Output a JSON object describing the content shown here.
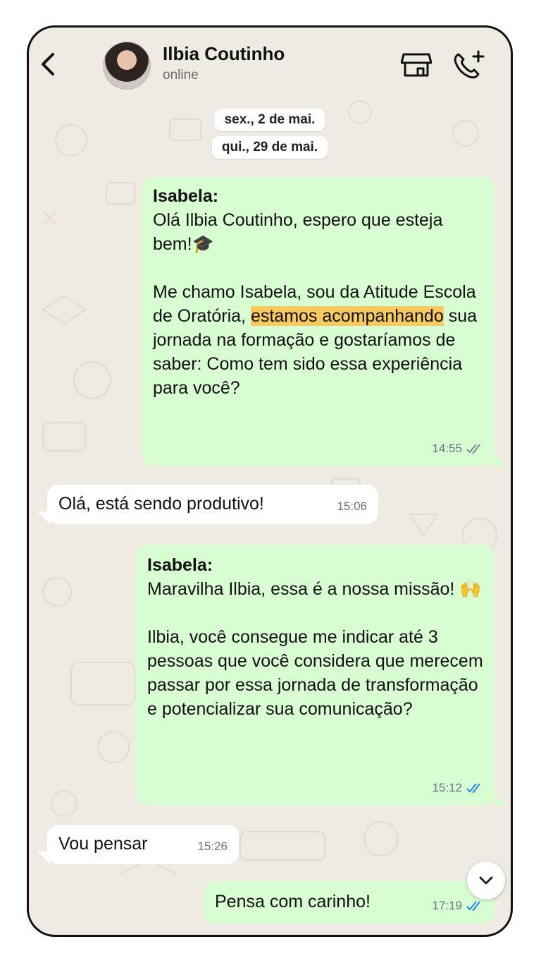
{
  "header": {
    "contact_name": "Ilbia Coutinho",
    "status": "online",
    "icons": [
      "back-chevron-icon",
      "avatar",
      "store-icon",
      "add-call-icon"
    ]
  },
  "dates": [
    "sex., 2 de mai.",
    "qui., 29 de mai."
  ],
  "messages": [
    {
      "direction": "outgoing",
      "sender": "Isabela:",
      "p1": "Olá Ilbia Coutinho, espero que esteja bem!🎓",
      "p2_before": "Me chamo Isabela, sou da Atitude Escola de Oratória, ",
      "p2_highlight": "estamos acompanhando",
      "p2_after": " sua jornada na formação e gostaríamos de saber: Como tem sido essa experiência para você?",
      "time": "14:55",
      "ticks": "read-gray"
    },
    {
      "direction": "incoming",
      "text": "Olá, está sendo produtivo!",
      "time": "15:06"
    },
    {
      "direction": "outgoing",
      "sender": "Isabela:",
      "p1": "Maravilha Ilbia, essa é a nossa missão! 🙌",
      "p2": "Ilbia, você consegue me indicar até 3 pessoas que você considera que merecem passar por essa jornada de transformação e potencializar sua comunicação?",
      "time": "15:12",
      "ticks": "read-blue"
    },
    {
      "direction": "incoming",
      "text": "Vou pensar",
      "time": "15:26"
    },
    {
      "direction": "outgoing",
      "text": "Pensa com carinho!",
      "time": "17:19",
      "ticks": "read-blue"
    }
  ],
  "colors": {
    "outgoing_bubble": "#d9fdd3",
    "incoming_bubble": "#ffffff",
    "background": "#efeae2",
    "highlight": "#f7c95f",
    "read_blue": "#1d8cf0"
  }
}
